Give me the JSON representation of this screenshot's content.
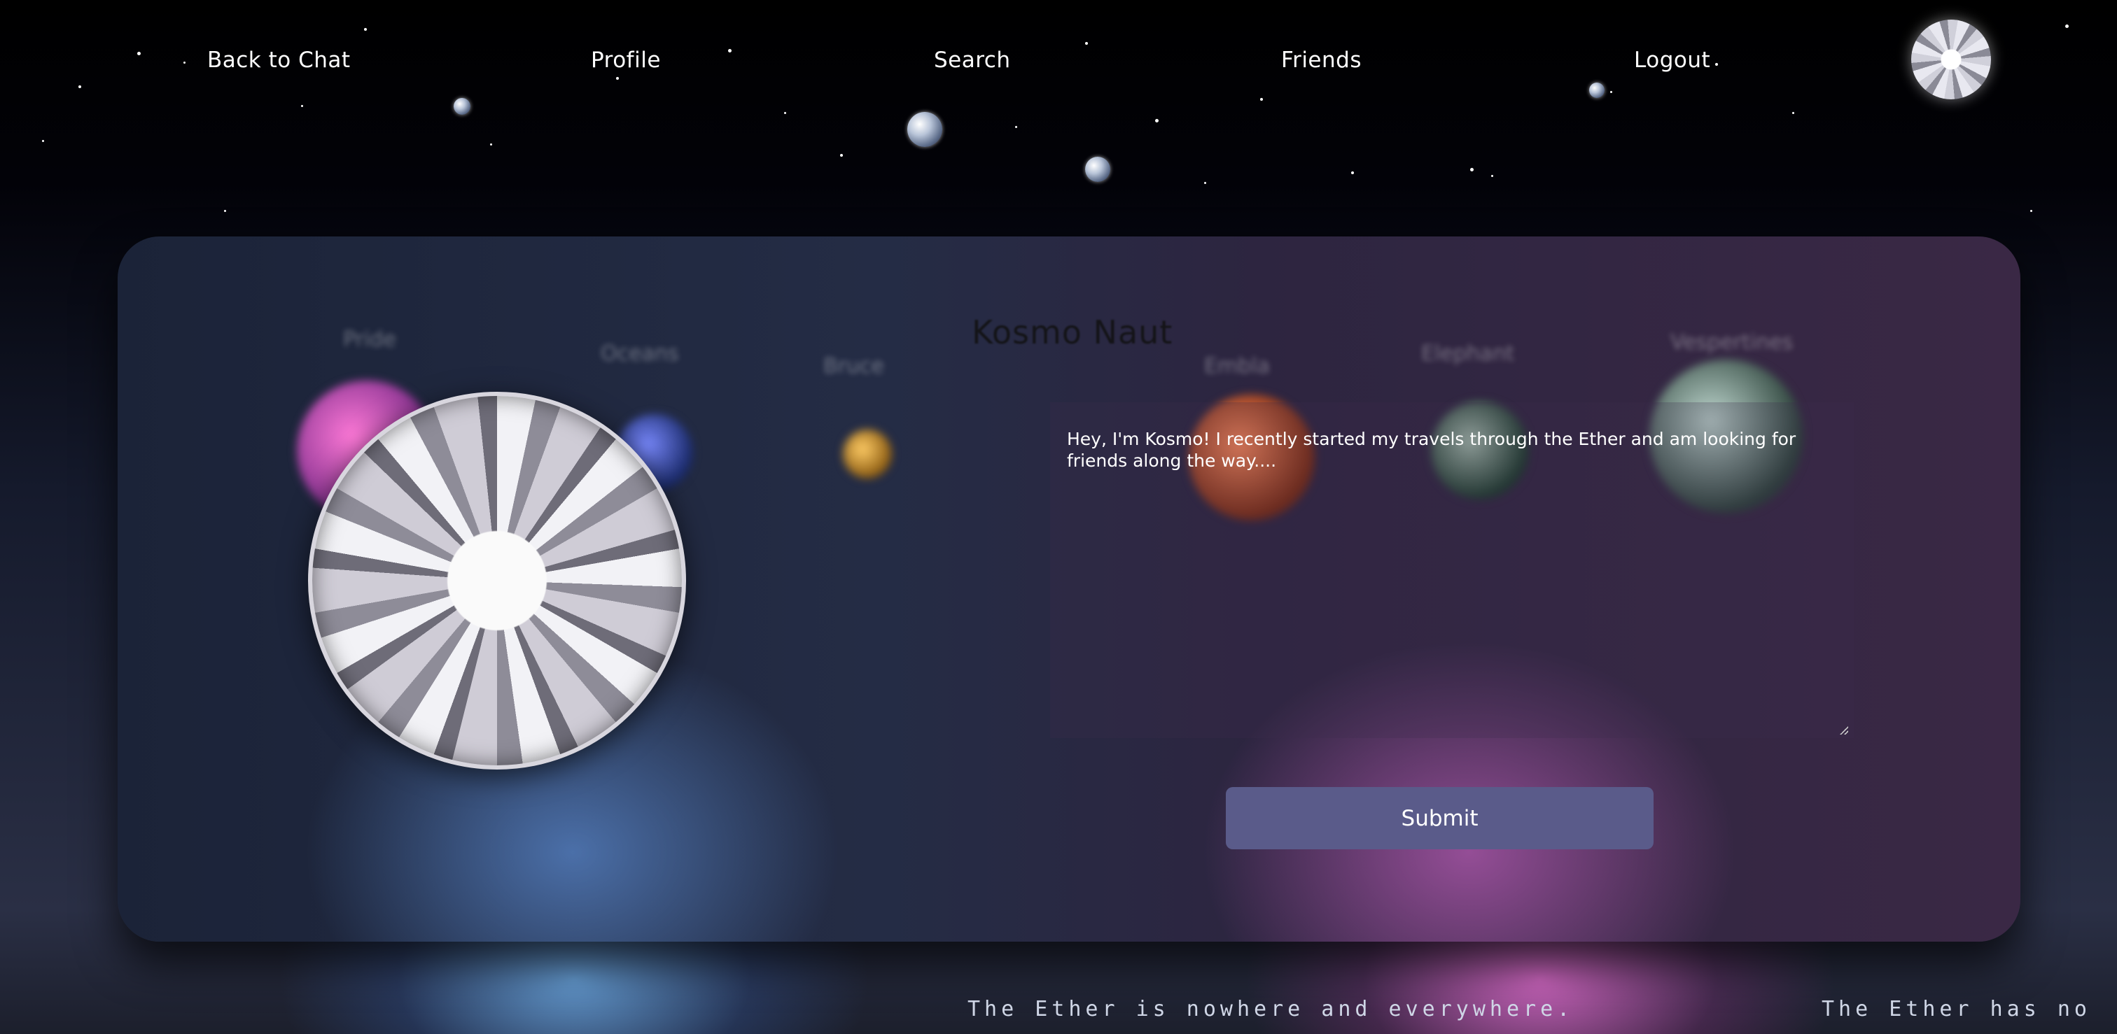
{
  "nav": {
    "back_to_chat": "Back to Chat",
    "profile": "Profile",
    "search": "Search",
    "friends": "Friends",
    "logout": "Logout",
    "avatar_icon": "profile-orb-icon"
  },
  "profile": {
    "name": "Kosmo Naut",
    "bio": "Hey, I'm Kosmo! I recently started my travels through the Ether and am looking for friends along the way....",
    "submit_label": "Submit"
  },
  "background_labels": [
    "Pride",
    "Oceans",
    "Bruce",
    "Embla",
    "Elephant",
    "Vespertines"
  ],
  "ticker": {
    "message_1": "The Ether is nowhere and everywhere.",
    "message_2": "The Ether has no"
  },
  "colors": {
    "accent_button": "#5a5b8a",
    "glow_blue": "#78beff",
    "glow_pink": "#ff78e6"
  }
}
